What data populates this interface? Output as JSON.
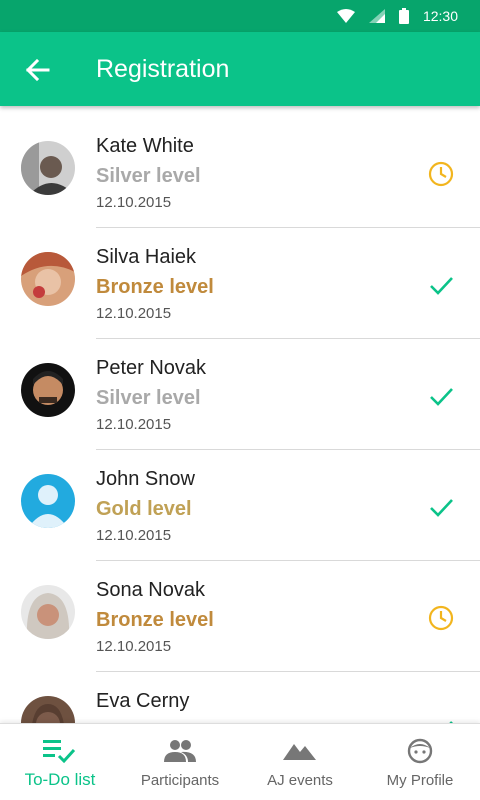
{
  "status_bar": {
    "time": "12:30"
  },
  "app_bar": {
    "title": "Registration"
  },
  "colors": {
    "primary": "#0bc389",
    "status_bar": "#07a56c",
    "silver": "#a9a9a9",
    "bronze": "#c08a3c",
    "gold": "#c0a155",
    "pending": "#f2b51e",
    "done": "#0bc389"
  },
  "registrations": [
    {
      "name": "Kate White",
      "level": "Silver level",
      "level_type": "silver",
      "date": "12.10.2015",
      "status": "pending"
    },
    {
      "name": "Silva Haiek",
      "level": "Bronze level",
      "level_type": "bronze",
      "date": "12.10.2015",
      "status": "done"
    },
    {
      "name": "Peter Novak",
      "level": "Silver level",
      "level_type": "silver",
      "date": "12.10.2015",
      "status": "done"
    },
    {
      "name": "John Snow",
      "level": "Gold level",
      "level_type": "gold",
      "date": "12.10.2015",
      "status": "done"
    },
    {
      "name": "Sona Novak",
      "level": "Bronze level",
      "level_type": "bronze",
      "date": "12.10.2015",
      "status": "pending"
    },
    {
      "name": "Eva Cerny",
      "level": "",
      "level_type": "",
      "date": "",
      "status": "done"
    }
  ],
  "bottom_nav": [
    {
      "label": "To-Do list",
      "icon": "todo-check-icon",
      "active": true
    },
    {
      "label": "Participants",
      "icon": "people-icon",
      "active": false
    },
    {
      "label": "AJ events",
      "icon": "mountains-icon",
      "active": false
    },
    {
      "label": "My Profile",
      "icon": "face-icon",
      "active": false
    }
  ]
}
